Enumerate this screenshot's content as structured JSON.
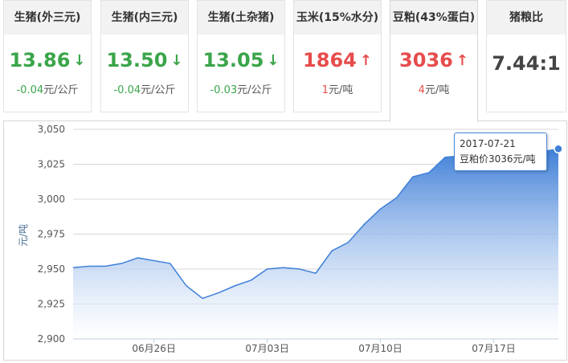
{
  "tabs": [
    {
      "title": "生猪(外三元)",
      "value": "13.86",
      "direction": "down",
      "change_num": "-0.04",
      "change_unit": "元/公斤"
    },
    {
      "title": "生猪(内三元)",
      "value": "13.50",
      "direction": "down",
      "change_num": "-0.04",
      "change_unit": "元/公斤"
    },
    {
      "title": "生猪(土杂猪)",
      "value": "13.05",
      "direction": "down",
      "change_num": "-0.03",
      "change_unit": "元/公斤"
    },
    {
      "title": "玉米(15%水分)",
      "value": "1864",
      "direction": "up",
      "change_num": "1",
      "change_unit": "元/吨"
    },
    {
      "title": "豆粕(43%蛋白)",
      "value": "3036",
      "direction": "up",
      "change_num": "4",
      "change_unit": "元/吨"
    },
    {
      "title": "猪粮比",
      "value": "7.44:1",
      "direction": "none",
      "change_num": "",
      "change_unit": ""
    }
  ],
  "active_tab": 4,
  "colors": {
    "down": "#3aa54a",
    "up": "#e74c4c",
    "series": "#4a89dc"
  },
  "icons": {
    "down": "arrow-down-icon",
    "up": "arrow-up-icon"
  },
  "tooltip": {
    "date": "2017-07-21",
    "label": "豆粕价3036元/吨"
  },
  "chart_data": {
    "type": "area",
    "ylabel": "元/吨",
    "ylim": [
      2900,
      3050
    ],
    "yticks": [
      "3,050",
      "3,025",
      "3,000",
      "2,975",
      "2,950",
      "2,925",
      "2,900"
    ],
    "xticks": [
      "06月26日",
      "07月03日",
      "07月10日",
      "07月17日"
    ],
    "grid": true,
    "series": [
      {
        "x": [
          "06月21日",
          "06月22日",
          "06月23日",
          "06月24日",
          "06月25日",
          "06月26日",
          "06月27日",
          "06月28日",
          "06月29日",
          "06月30日",
          "07月01日",
          "07月02日",
          "07月03日",
          "07月04日",
          "07月05日",
          "07月06日",
          "07月07日",
          "07月08日",
          "07月09日",
          "07月10日",
          "07月11日",
          "07月12日",
          "07月13日",
          "07月14日",
          "07月15日",
          "07月16日",
          "07月17日",
          "07月18日",
          "07月19日",
          "07月20日",
          "07月21日"
        ],
        "values": [
          2951,
          2952,
          2952,
          2954,
          2958,
          2956,
          2954,
          2938,
          2929,
          2933,
          2938,
          2942,
          2950,
          2951,
          2950,
          2947,
          2963,
          2969,
          2982,
          2993,
          3001,
          3016,
          3019,
          3030,
          3031,
          3031,
          3032,
          3033,
          3034,
          3034,
          3036
        ]
      }
    ]
  }
}
